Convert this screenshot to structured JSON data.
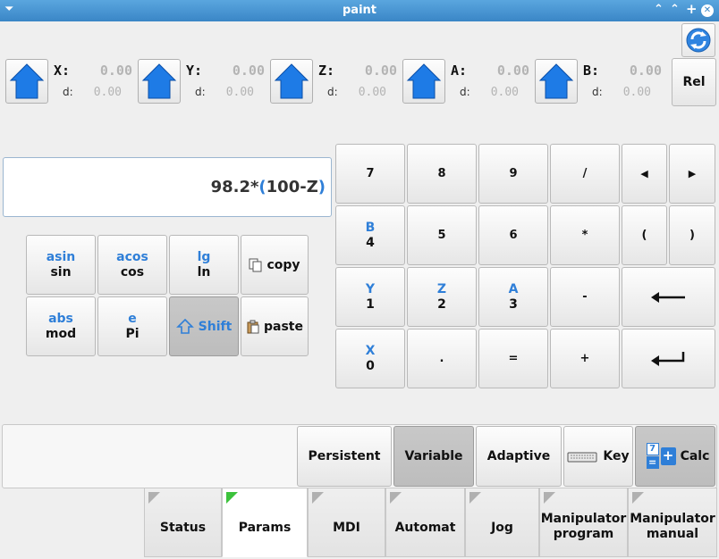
{
  "window": {
    "title": "paint"
  },
  "axes": [
    {
      "name": "X:",
      "value": "0.00",
      "d_label": "d:",
      "d_value": "0.00"
    },
    {
      "name": "Y:",
      "value": "0.00",
      "d_label": "d:",
      "d_value": "0.00"
    },
    {
      "name": "Z:",
      "value": "0.00",
      "d_label": "d:",
      "d_value": "0.00"
    },
    {
      "name": "A:",
      "value": "0.00",
      "d_label": "d:",
      "d_value": "0.00"
    },
    {
      "name": "B:",
      "value": "0.00",
      "d_label": "d:",
      "d_value": "0.00"
    }
  ],
  "rel_label": "Rel",
  "expression": {
    "part1": "98.2*",
    "paren_open": "(",
    "inner": "100-Z",
    "paren_close": ")"
  },
  "functions": {
    "asin": "asin",
    "sin": "sin",
    "acos": "acos",
    "cos": "cos",
    "lg": "lg",
    "ln": "ln",
    "copy": "copy",
    "abs": "abs",
    "mod": "mod",
    "e": "e",
    "pi": "Pi",
    "shift": "Shift",
    "paste": "paste"
  },
  "keypad": {
    "k7": "7",
    "k8": "8",
    "k9": "9",
    "div": "/",
    "left": "◀",
    "right": "▶",
    "b": "B",
    "k4": "4",
    "k5": "5",
    "k6": "6",
    "mul": "*",
    "lparen": "(",
    "rparen": ")",
    "y": "Y",
    "k1": "1",
    "z": "Z",
    "k2": "2",
    "a": "A",
    "k3": "3",
    "minus": "-",
    "x": "X",
    "k0": "0",
    "dot": ".",
    "eq": "=",
    "plus": "+"
  },
  "modes": {
    "persistent": "Persistent",
    "variable": "Variable",
    "adaptive": "Adaptive",
    "key": "Key",
    "calc": "Calc",
    "calc_icon_top": "7",
    "calc_icon_bottom": "=",
    "calc_icon_plus": "+"
  },
  "tabs": {
    "status": "Status",
    "params": "Params",
    "mdi": "MDI",
    "automat": "Automat",
    "jog": "Jog",
    "manip_prog_1": "Manipulator",
    "manip_prog_2": "program",
    "manip_man_1": "Manipulator",
    "manip_man_2": "manual"
  },
  "colors": {
    "accent": "#2f7fd8",
    "titlebar": "#3a86c6",
    "home_icon": "#1e7be6",
    "active_tab_marker": "#3cc23c"
  }
}
